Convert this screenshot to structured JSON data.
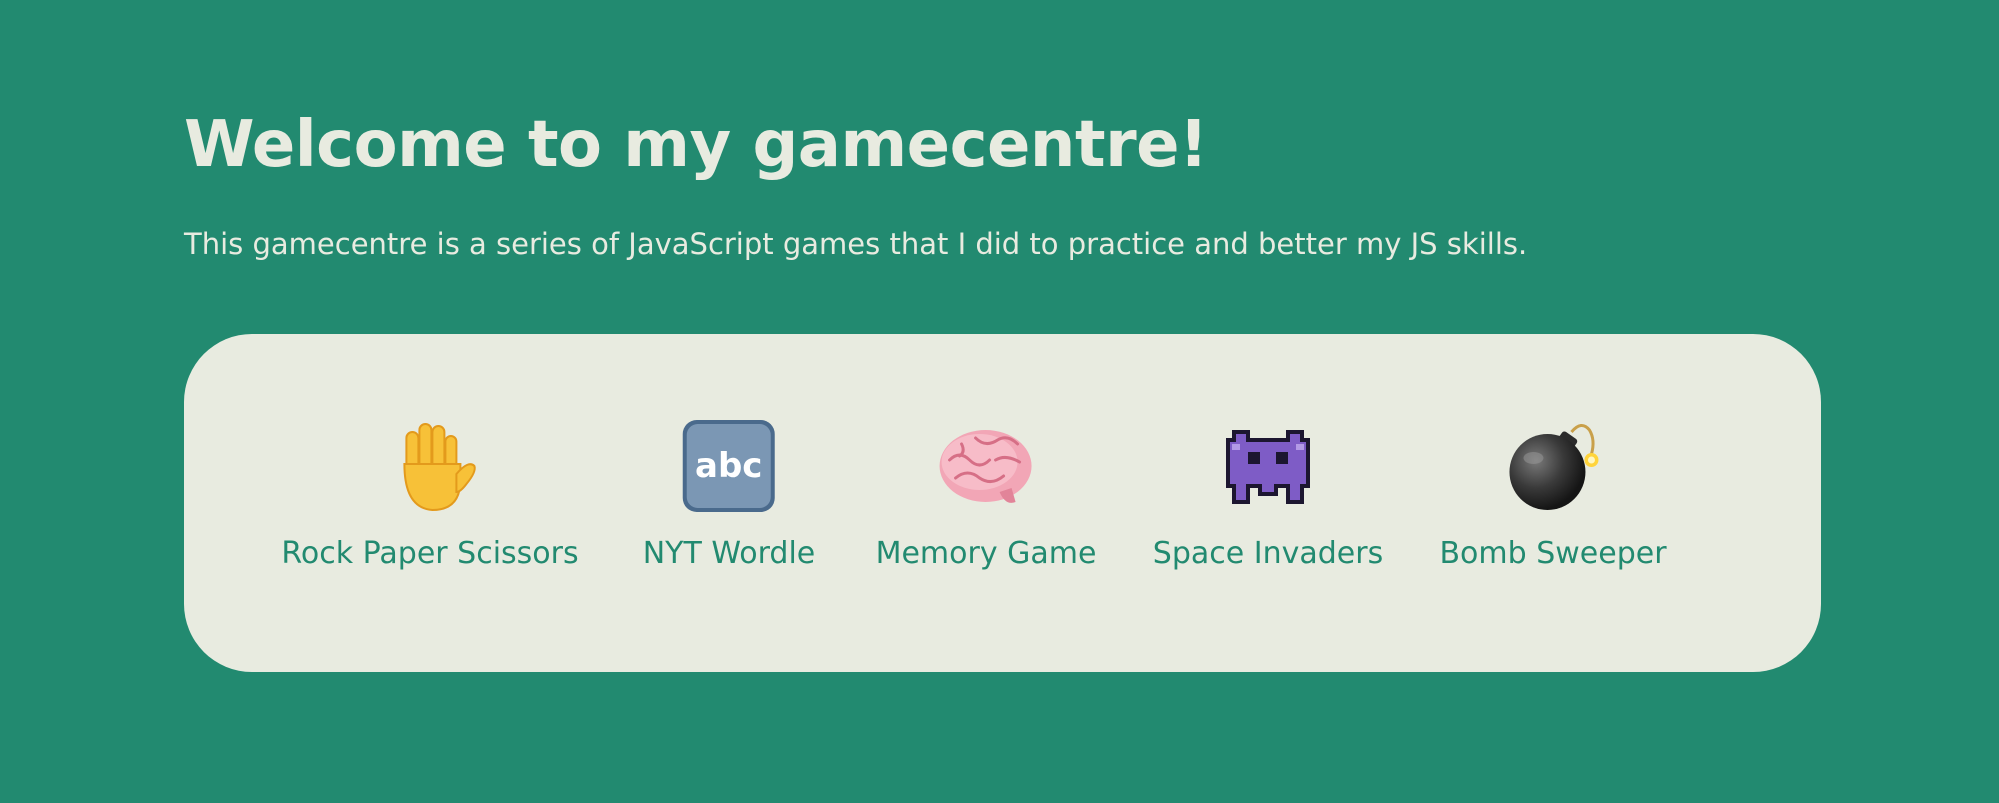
{
  "header": {
    "title": "Welcome to my gamecentre!",
    "intro": "This gamecentre is a series of JavaScript games that I did to practice and better my JS skills."
  },
  "games": [
    {
      "label": "Rock Paper Scissors",
      "icon": "raised-hand-icon"
    },
    {
      "label": "NYT Wordle",
      "icon": "abc-icon"
    },
    {
      "label": "Memory Game",
      "icon": "brain-icon"
    },
    {
      "label": "Space Invaders",
      "icon": "alien-invader-icon"
    },
    {
      "label": "Bomb Sweeper",
      "icon": "bomb-icon"
    }
  ],
  "colors": {
    "background": "#228a70",
    "panel": "#e8ebe0",
    "accent": "#228a70"
  }
}
